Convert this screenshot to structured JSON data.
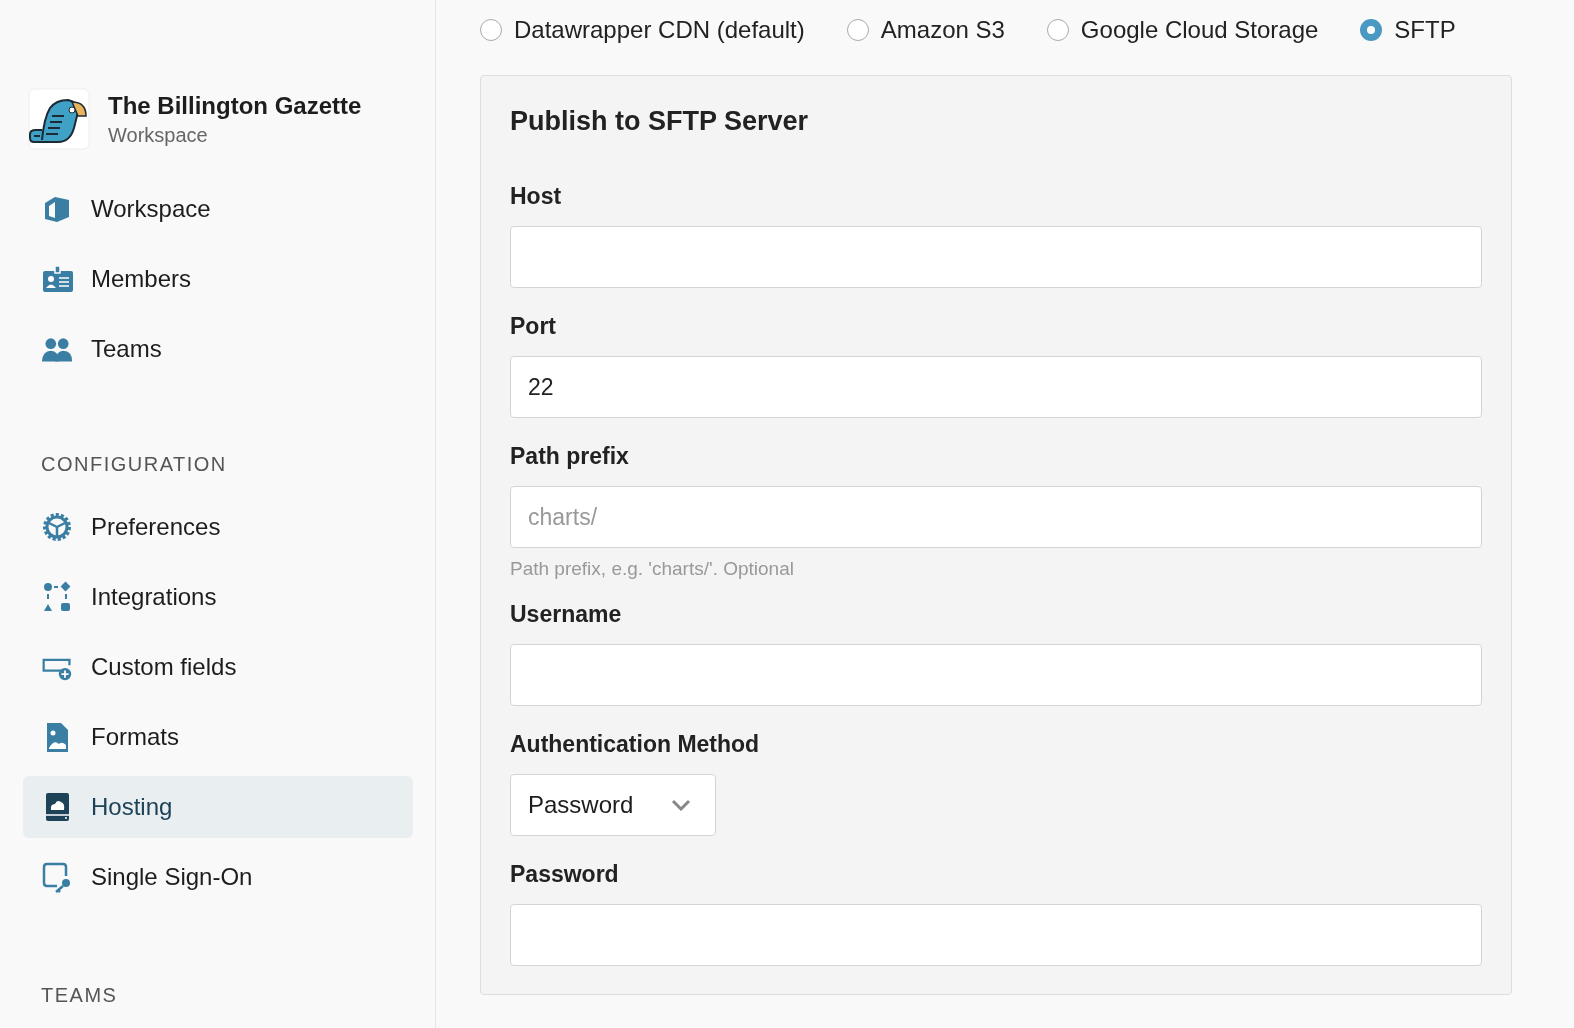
{
  "sidebar": {
    "org": {
      "name": "The Billington Gazette",
      "subtitle": "Workspace"
    },
    "items": [
      {
        "label": "Workspace",
        "selected": false
      },
      {
        "label": "Members",
        "selected": false
      },
      {
        "label": "Teams",
        "selected": false
      }
    ],
    "sections": [
      {
        "heading": "CONFIGURATION",
        "items": [
          {
            "label": "Preferences",
            "selected": false
          },
          {
            "label": "Integrations",
            "selected": false
          },
          {
            "label": "Custom fields",
            "selected": false
          },
          {
            "label": "Formats",
            "selected": false
          },
          {
            "label": "Hosting",
            "selected": true
          },
          {
            "label": "Single Sign-On",
            "selected": false
          }
        ]
      },
      {
        "heading": "TEAMS"
      }
    ]
  },
  "hosting_options": [
    {
      "label": "Datawrapper CDN (default)",
      "selected": false
    },
    {
      "label": "Amazon S3",
      "selected": false
    },
    {
      "label": "Google Cloud Storage",
      "selected": false
    },
    {
      "label": "SFTP",
      "selected": true
    }
  ],
  "panel": {
    "title": "Publish to SFTP Server",
    "fields": [
      {
        "kind": "text",
        "label": "Host"
      },
      {
        "kind": "text",
        "label": "Port",
        "value": "22"
      },
      {
        "kind": "text",
        "label": "Path prefix",
        "placeholder": "charts/",
        "hint": "Path prefix, e.g. 'charts/'. Optional"
      },
      {
        "kind": "text",
        "label": "Username"
      },
      {
        "kind": "select",
        "label": "Authentication Method",
        "value": "Password"
      },
      {
        "kind": "text",
        "label": "Password"
      }
    ]
  }
}
